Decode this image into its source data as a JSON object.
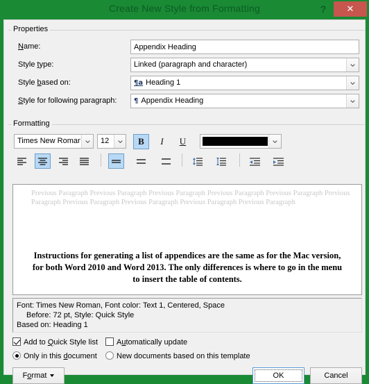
{
  "window": {
    "title": "Create New Style from Formatting",
    "help_label": "?",
    "close_label": "✕",
    "titlebar_color": "#1a8a35",
    "close_color": "#c7564f"
  },
  "properties": {
    "group_label": "Properties",
    "name_label": "Name:",
    "name_value": "Appendix Heading",
    "style_type_label": "Style type:",
    "style_type_value": "Linked (paragraph and character)",
    "style_based_on_label": "Style based on:",
    "style_based_on_icon": "¶a",
    "style_based_on_value": "Heading 1",
    "style_following_label": "Style for following paragraph:",
    "style_following_icon": "¶",
    "style_following_value": "Appendix Heading"
  },
  "formatting": {
    "group_label": "Formatting",
    "font_family": "Times New Roman",
    "font_size": "12",
    "bold_label": "B",
    "italic_label": "I",
    "underline_label": "U",
    "font_color": "#000000",
    "bold_active": true,
    "italic_active": false,
    "underline_active": false,
    "align_active": "center",
    "line_spacing_active": "single"
  },
  "preview": {
    "previous_paragraph_text": "Previous Paragraph Previous Paragraph Previous Paragraph Previous Paragraph Previous Paragraph Previous Paragraph Previous Paragraph Previous Paragraph Previous Paragraph Previous Paragraph",
    "sample_text": "Instructions for generating a list of appendices are the same as for the Mac version, for both Word 2010 and Word 2013. The only differences is where to go in the menu to insert the table of contents."
  },
  "description": {
    "line1": "Font: Times New Roman, Font color: Text 1, Centered, Space",
    "line2": "Before:  72 pt, Style: Quick Style",
    "line3": "Based on: Heading 1"
  },
  "options": {
    "add_quick_style_label": "Add to Quick Style list",
    "add_quick_style_checked": true,
    "auto_update_label": "Automatically update",
    "auto_update_checked": false,
    "only_this_document_label": "Only in this document",
    "only_this_document_selected": true,
    "new_documents_label": "New documents based on this template",
    "new_documents_selected": false
  },
  "buttons": {
    "format_label": "Format",
    "ok_label": "OK",
    "cancel_label": "Cancel"
  }
}
